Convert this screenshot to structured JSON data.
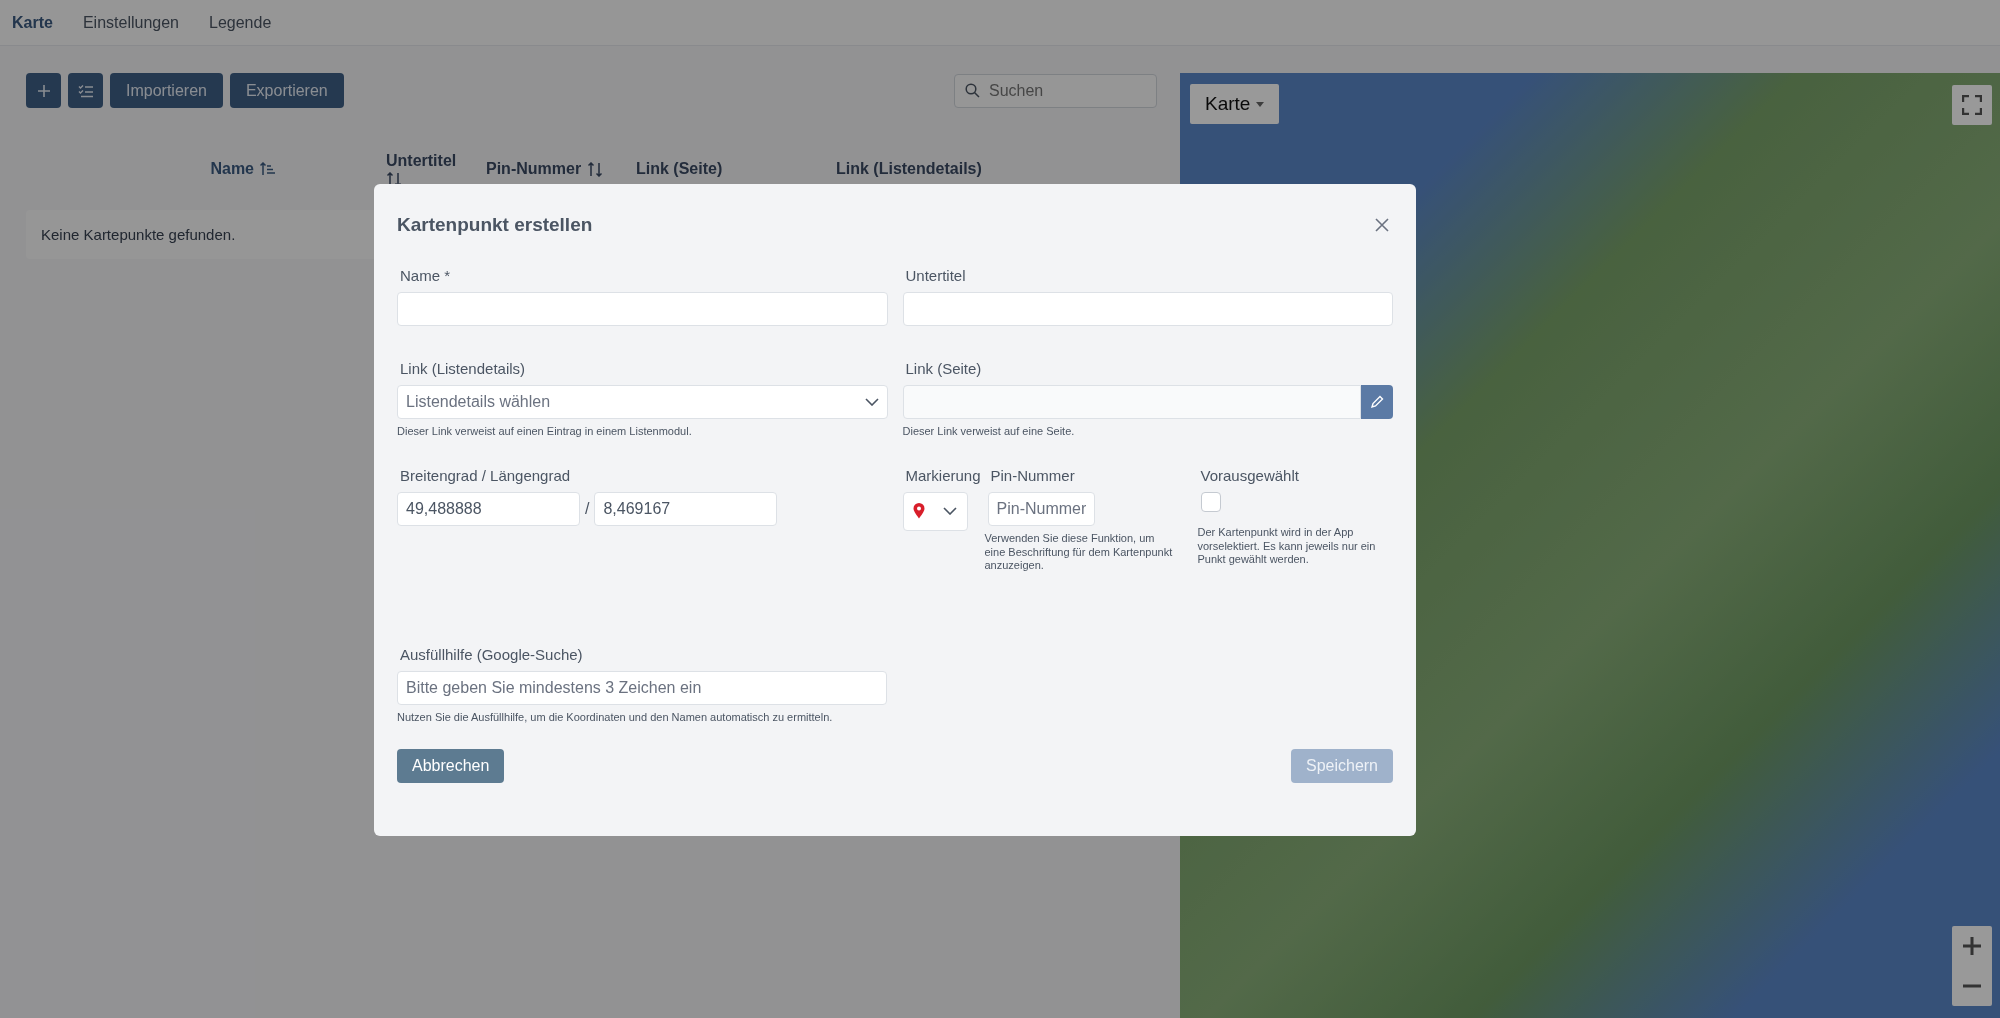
{
  "nav_tabs": [
    {
      "label": "Karte",
      "selected": true
    },
    {
      "label": "Einstellungen",
      "selected": false
    },
    {
      "label": "Legende",
      "selected": false
    }
  ],
  "toolbar": {
    "buttons": [
      {
        "kind": "add"
      },
      {
        "kind": "list"
      },
      {
        "kind": "text",
        "label": "Importieren"
      },
      {
        "kind": "text",
        "label": "Exportieren"
      }
    ],
    "search": {
      "placeholder": "Suchen"
    }
  },
  "table": {
    "columns": [
      {
        "label": "Name",
        "sortable": true,
        "sorted_ascending": true
      },
      {
        "label": "Untertitel",
        "sortable": true,
        "sorted_ascending": false
      },
      {
        "label": "Pin-Nummer",
        "sortable": true,
        "sorted_ascending": false
      },
      {
        "label": "Link (Seite)"
      },
      {
        "label": "Link (Listendetails)"
      }
    ],
    "empty_message": "Keine Kartepunkte gefunden."
  },
  "map": {
    "type_button": "Karte"
  },
  "dialog": {
    "title": "Kartenpunkt erstellen",
    "name": {
      "label": "Name *"
    },
    "subtitle": {
      "label": "Untertitel"
    },
    "list_link": {
      "label": "Link (Listendetails)",
      "placeholder": "Listendetails wählen",
      "help": "Dieser Link verweist auf einen Eintrag in einem Listenmodul."
    },
    "page_link": {
      "label": "Link (Seite)",
      "help": "Dieser Link verweist auf eine Seite."
    },
    "coordinates": {
      "label": "Breitengrad / Längengrad",
      "latitude": "49,488888",
      "separator": "/",
      "longitude": "8,469167"
    },
    "marker": {
      "label": "Markierung"
    },
    "pin_number": {
      "label": "Pin-Nummer",
      "placeholder": "Pin-Nummer",
      "help": "Verwenden Sie diese Funktion, um eine Beschriftung für dem Kartenpunkt anzuzeigen."
    },
    "preselected": {
      "label": "Vorausgewählt",
      "checked": false,
      "help": "Der Kartenpunkt wird in der App vorselektiert. Es kann jeweils nur ein Punkt gewählt werden."
    },
    "autocomplete": {
      "label": "Ausfüllhilfe (Google-Suche)",
      "placeholder": "Bitte geben Sie mindestens 3 Zeichen ein",
      "help": "Nutzen Sie die Ausfüllhilfe, um die Koordinaten und den Namen automatisch zu ermitteln."
    },
    "cancel": "Abbrechen",
    "save": {
      "label": "Speichern",
      "disabled": true
    }
  }
}
